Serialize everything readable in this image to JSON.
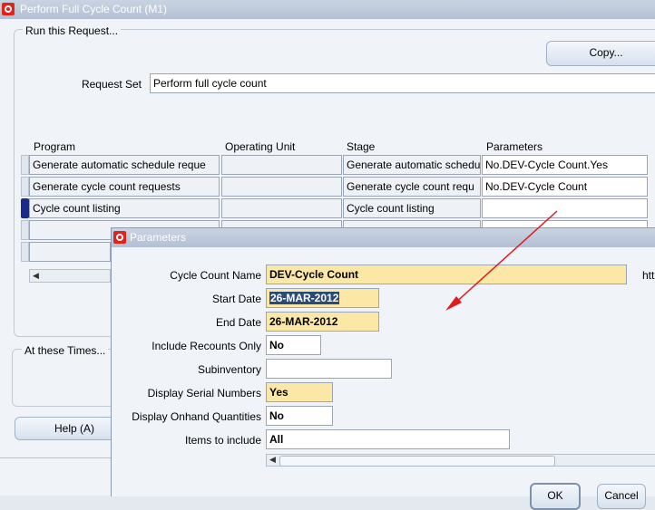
{
  "window": {
    "title": "Perform Full Cycle Count (M1)"
  },
  "run_request": {
    "legend": "Run this Request...",
    "copy_button": "Copy...",
    "request_set_label": "Request Set",
    "request_set_value": "Perform full cycle count"
  },
  "table": {
    "headers": {
      "program": "Program",
      "operating_unit": "Operating Unit",
      "stage": "Stage",
      "parameters": "Parameters"
    },
    "rows": [
      {
        "program": "Generate automatic schedule reque",
        "operating_unit": "",
        "stage": "Generate automatic schedu",
        "parameters": "No.DEV-Cycle Count.Yes"
      },
      {
        "program": "Generate cycle count requests",
        "operating_unit": "",
        "stage": "Generate cycle count requ",
        "parameters": "No.DEV-Cycle Count"
      },
      {
        "program": "Cycle count listing",
        "operating_unit": "",
        "stage": "Cycle count listing",
        "parameters": ""
      }
    ]
  },
  "times": {
    "legend": "At these Times..."
  },
  "help_button": "Help (A)",
  "dialog": {
    "title": "Parameters",
    "cycle_count_name_label": "Cycle Count Name",
    "cycle_count_name_value": "DEV-Cycle Count",
    "trailing_text": "htt",
    "start_date_label": "Start Date",
    "start_date_value": "26-MAR-2012",
    "end_date_label": "End Date",
    "end_date_value": "26-MAR-2012",
    "include_recounts_label": "Include Recounts Only",
    "include_recounts_value": "No",
    "subinventory_label": "Subinventory",
    "subinventory_value": "",
    "display_serial_label": "Display Serial Numbers",
    "display_serial_value": "Yes",
    "display_onhand_label": "Display Onhand Quantities",
    "display_onhand_value": "No",
    "items_to_include_label": "Items to include",
    "items_to_include_value": "All",
    "ok_button": "OK",
    "cancel_button": "Cancel"
  },
  "colors": {
    "arrow": "#e21b1b",
    "required_field": "#fbe8a6",
    "titlebar": "#b3c0d4"
  }
}
